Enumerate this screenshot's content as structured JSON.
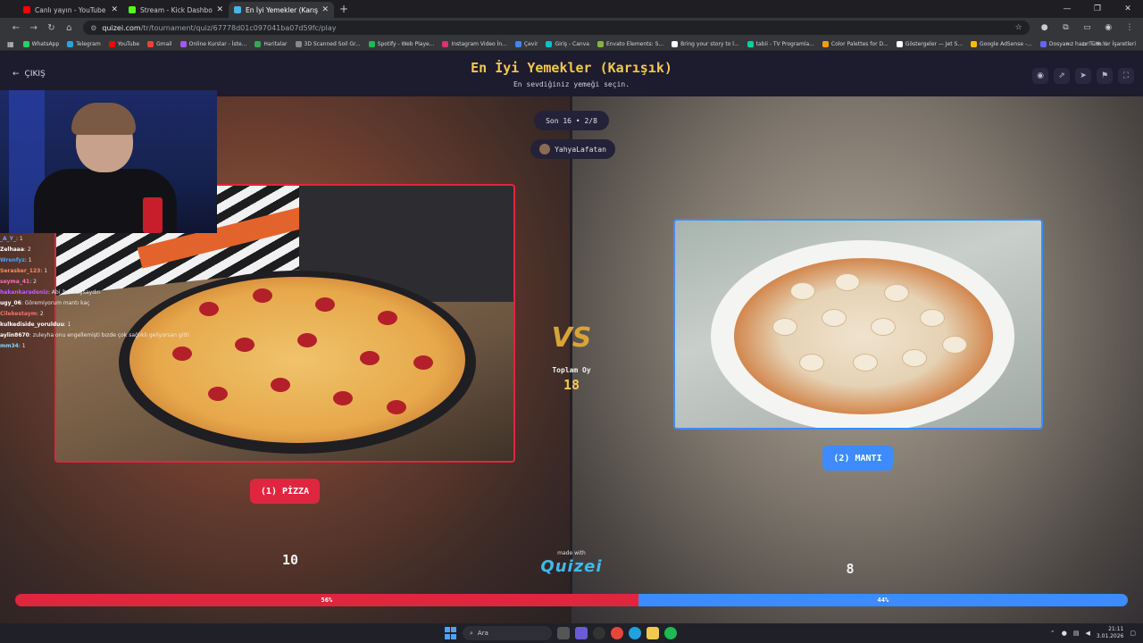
{
  "browser": {
    "tabs": [
      {
        "label": "Canlı yayın - YouTube Studio",
        "color": "#ff0000"
      },
      {
        "label": "Stream - Kick Dashboard",
        "color": "#53fc18"
      },
      {
        "label": "En İyi Yemekler (Karışık) - Tier L",
        "color": "#3fb8f0"
      }
    ],
    "new_tab": "+",
    "url_host": "quizei.com",
    "url_path": "/tr/tournament/quiz/67778d01c097041ba07d59fc/play",
    "bookmarks": [
      {
        "label": "WhatsApp",
        "color": "#25d366"
      },
      {
        "label": "Telegram",
        "color": "#2aa3e0"
      },
      {
        "label": "YouTube",
        "color": "#ff0000"
      },
      {
        "label": "Gmail",
        "color": "#ea4335"
      },
      {
        "label": "Online Kurslar - İste...",
        "color": "#a855f7"
      },
      {
        "label": "Haritalar",
        "color": "#34a853"
      },
      {
        "label": "3D Scanned Soil Gr...",
        "color": "#888888"
      },
      {
        "label": "Spotify - Web Playe...",
        "color": "#1db954"
      },
      {
        "label": "Instagram Video İn...",
        "color": "#e1306c"
      },
      {
        "label": "Çevir",
        "color": "#4285f4"
      },
      {
        "label": "Giriş - Canva",
        "color": "#00c4cc"
      },
      {
        "label": "Envato Elements: S...",
        "color": "#82b541"
      },
      {
        "label": "Bring your story to l...",
        "color": "#ffffff"
      },
      {
        "label": "tabii - TV Programla...",
        "color": "#00d1a0"
      },
      {
        "label": "Color Palettes for D...",
        "color": "#f59e0b"
      },
      {
        "label": "Göstergeler — Jet S...",
        "color": "#ffffff"
      },
      {
        "label": "Google AdSense -...",
        "color": "#fbbc05"
      },
      {
        "label": "Dosyanız hazır! - Yo...",
        "color": "#6366f1"
      }
    ],
    "bookmarks_more": "»",
    "all_bookmarks": "Tüm Yer İşaretleri"
  },
  "header": {
    "exit_label": "ÇIKIŞ",
    "title": "En İyi Yemekler (Karışık)",
    "subtitle": "En sevdiğiniz yemeği seçin."
  },
  "round": {
    "label": "Son 16 • 2/8",
    "user": "YahyaLafatan"
  },
  "chat": [
    {
      "user": "_A_Y_",
      "text": ": 1",
      "color": "#7c9cff"
    },
    {
      "user": "Zelhaaa",
      "text": ": 2",
      "color": "#ffffff"
    },
    {
      "user": "Wrenfyz",
      "text": ": 1",
      "color": "#4aa3ff"
    },
    {
      "user": "Serasker_123",
      "text": ": 1",
      "color": "#ff8a5c"
    },
    {
      "user": "seyma_41",
      "text": ": 2",
      "color": "#ff6fb0"
    },
    {
      "user": "hakankaradeniz",
      "text": ": Abi 3v3 koysaydın",
      "color": "#c05cff"
    },
    {
      "user": "ugy_06",
      "text": ": Göremiyorum mantı kaç",
      "color": "#ffffff"
    },
    {
      "user": "Cilekestaym",
      "text": ": 2",
      "color": "#ff6f6f"
    },
    {
      "user": "kulkediside_yorulduu",
      "text": ": 1",
      "color": "#ffffff"
    },
    {
      "user": "aylin8670",
      "text": ": zuleyha onu engellemişti bızde çok sağlıklı geliyorsan gitti",
      "color": "#ffffff"
    },
    {
      "user": "mm34",
      "text": ": 1",
      "color": "#7cd6ff"
    }
  ],
  "left": {
    "choice_label": "(1) PİZZA",
    "count": "10",
    "percent_label": "56%",
    "percent": 56
  },
  "right": {
    "choice_label": "(2) MANTI",
    "count": "8",
    "percent_label": "44%",
    "percent": 44
  },
  "center": {
    "vs": "VS",
    "total_label": "Toplam Oy",
    "total_value": "18",
    "made_with": "made with",
    "brand": "Quizei"
  },
  "taskbar": {
    "search_placeholder": "Ara",
    "time": "21:11",
    "date": "3.01.2026"
  },
  "colors": {
    "accent_red": "#e0263f",
    "accent_blue": "#3d8bff",
    "title_yellow": "#f2c94c"
  }
}
